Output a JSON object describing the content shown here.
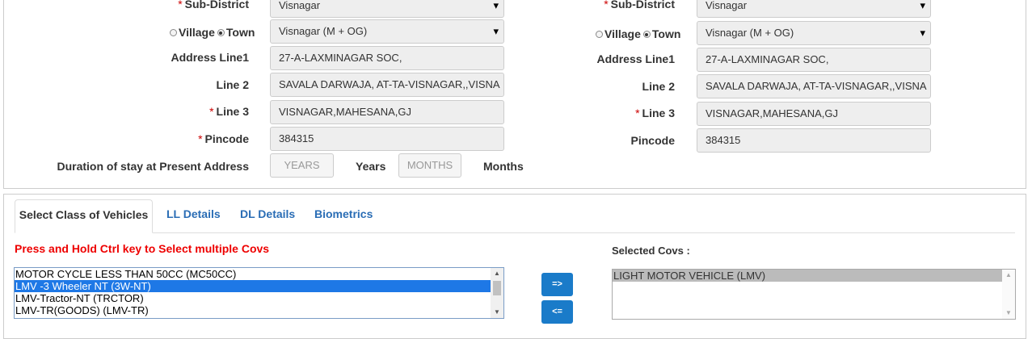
{
  "present_address": {
    "sub_district_label": "Sub-District",
    "sub_district_value": "Visnagar",
    "village_label": "Village",
    "town_label": "Town",
    "town_value": "Visnagar (M + OG)",
    "address_line1_label": "Address Line1",
    "address_line1_value": "27-A-LAXMINAGAR SOC,",
    "line2_label": "Line 2",
    "line2_value": "SAVALA DARWAJA,  AT-TA-VISNAGAR,,VISNA",
    "line3_label": "Line 3",
    "line3_value": "VISNAGAR,MAHESANA,GJ",
    "pincode_label": "Pincode",
    "pincode_value": "384315",
    "duration_label": "Duration of stay at Present Address",
    "years_placeholder": "YEARS",
    "years_label": "Years",
    "months_placeholder": "MONTHS",
    "months_label": "Months"
  },
  "permanent_address": {
    "sub_district_label": "Sub-District",
    "sub_district_value": "Visnagar",
    "village_label": "Village",
    "town_label": "Town",
    "town_value": "Visnagar (M + OG)",
    "address_line1_label": "Address Line1",
    "address_line1_value": "27-A-LAXMINAGAR SOC,",
    "line2_label": "Line 2",
    "line2_value": "SAVALA DARWAJA,  AT-TA-VISNAGAR,,VISNA",
    "line3_label": "Line 3",
    "line3_value": "VISNAGAR,MAHESANA,GJ",
    "pincode_label": "Pincode",
    "pincode_value": "384315"
  },
  "required_mark": "*",
  "tabs": [
    {
      "label": "Select Class of Vehicles"
    },
    {
      "label": "LL Details"
    },
    {
      "label": "DL Details"
    },
    {
      "label": "Biometrics"
    }
  ],
  "cov": {
    "hint": "Press and Hold Ctrl key to Select multiple Covs",
    "available": [
      "MOTOR CYCLE LESS THAN 50CC (MC50CC)",
      "LMV -3 Wheeler NT (3W-NT)",
      "LMV-Tractor-NT (TRCTOR)",
      "LMV-TR(GOODS) (LMV-TR)"
    ],
    "selected_label": "Selected Covs :",
    "selected": [
      "LIGHT MOTOR VEHICLE (LMV)"
    ],
    "add_button": "=>",
    "remove_button": "<="
  },
  "colors": {
    "required": "#cc0000",
    "hint": "#ee0000",
    "tab_link": "#2a6db5",
    "button": "#1a7bc9",
    "selection": "#1e78e6"
  }
}
